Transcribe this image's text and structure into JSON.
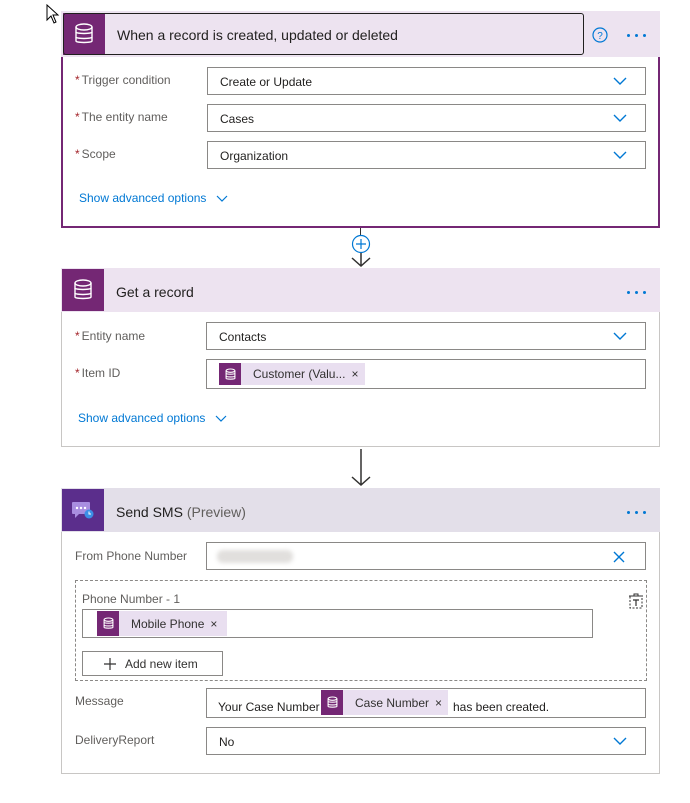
{
  "trigger": {
    "title": "When a record is created, updated or deleted",
    "fields": [
      {
        "label": "Trigger condition",
        "value": "Create or Update"
      },
      {
        "label": "The entity name",
        "value": "Cases"
      },
      {
        "label": "Scope",
        "value": "Organization"
      }
    ],
    "advanced": "Show advanced options"
  },
  "get_record": {
    "title": "Get a record",
    "entity_label": "Entity name",
    "entity_value": "Contacts",
    "item_label": "Item ID",
    "item_token": "Customer (Valu...",
    "advanced": "Show advanced options"
  },
  "send_sms": {
    "title": "Send SMS",
    "title_suffix": "(Preview)",
    "from_label": "From Phone Number",
    "phone_group_label": "Phone Number - 1",
    "phone_token": "Mobile Phone",
    "add_item": "Add new item",
    "message_label": "Message",
    "message_prefix": "Your Case Number",
    "message_token": "Case Number",
    "message_suffix": "has been created.",
    "delivery_label": "DeliveryReport",
    "delivery_value": "No"
  },
  "token_close": "×",
  "colors": {
    "dataverse": "#742774",
    "sms": "#5b2e8c",
    "accent": "#0078d4",
    "header_bg": "#ede3f0",
    "required": "#a4262c"
  },
  "icons": [
    "cursor-icon",
    "database-icon",
    "help-icon",
    "more-icon",
    "chevron-down-icon",
    "add-step-icon",
    "arrow-down-icon",
    "sms-icon",
    "clear-icon",
    "delete-icon",
    "plus-icon"
  ]
}
